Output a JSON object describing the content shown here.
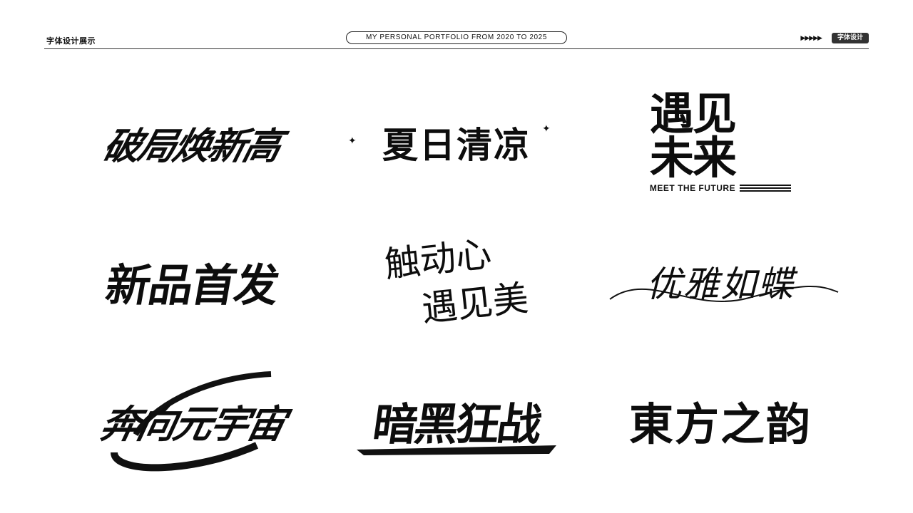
{
  "header": {
    "left_title": "字体设计展示",
    "center_title": "MY PERSONAL PORTFOLIO FROM 2020 TO 2025",
    "arrows": "▶▶▶▶▶",
    "tag": "字体设计"
  },
  "works": [
    {
      "text": "破局焕新高"
    },
    {
      "text": "夏日清凉"
    },
    {
      "text": "遇见",
      "line2": "未来",
      "subtitle": "MEET THE FUTURE"
    },
    {
      "text": "新品首发"
    },
    {
      "text": "触动心",
      "line2": "遇见美"
    },
    {
      "text": "优雅如蝶"
    },
    {
      "text": "奔向元宇宙"
    },
    {
      "text": "暗黑狂战"
    },
    {
      "text": "東方之韵"
    }
  ],
  "icons": {
    "sparkle": "✦",
    "arrow": "arrow-icon"
  }
}
